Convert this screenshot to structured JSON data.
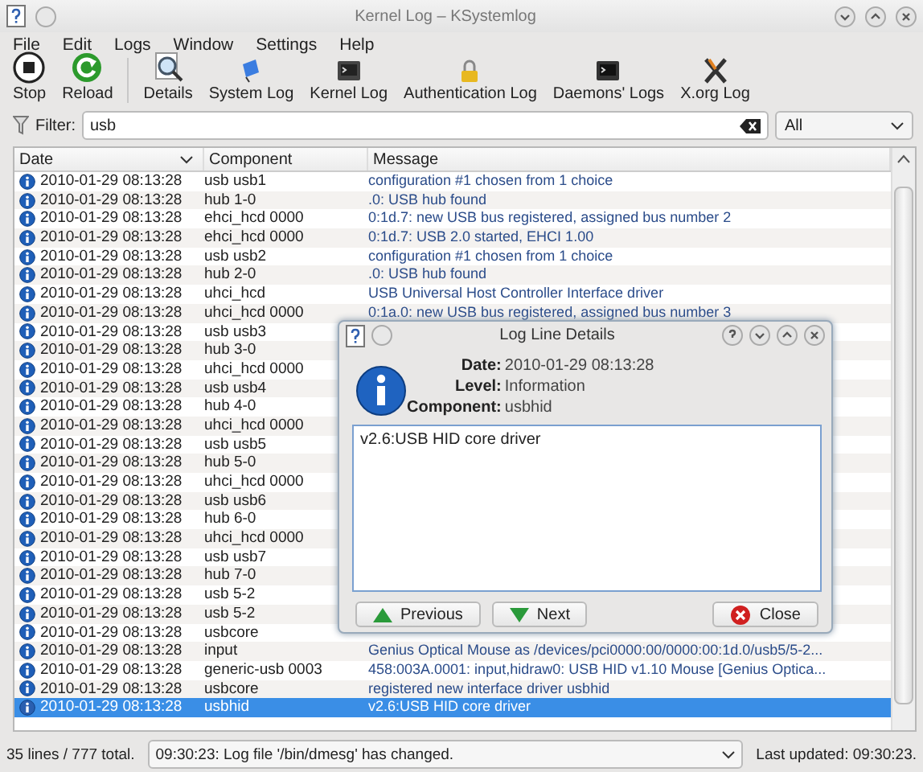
{
  "window": {
    "title": "Kernel Log – KSystemlog"
  },
  "menu": [
    "File",
    "Edit",
    "Logs",
    "Window",
    "Settings",
    "Help"
  ],
  "toolbar": [
    {
      "label": "Stop",
      "kind": "stop"
    },
    {
      "label": "Reload",
      "kind": "reload"
    },
    {
      "label": "Details",
      "kind": "details"
    },
    {
      "label": "System Log",
      "kind": "system"
    },
    {
      "label": "Kernel Log",
      "kind": "kernel"
    },
    {
      "label": "Authentication Log",
      "kind": "auth"
    },
    {
      "label": "Daemons' Logs",
      "kind": "daemons"
    },
    {
      "label": "X.org Log",
      "kind": "xorg"
    }
  ],
  "filter": {
    "label": "Filter:",
    "value": "usb",
    "scope": "All"
  },
  "table": {
    "columns": [
      {
        "label": "Date",
        "sorted": true
      },
      {
        "label": "Component",
        "sorted": false
      },
      {
        "label": "Message",
        "sorted": false
      }
    ],
    "rows": [
      {
        "date": "2010-01-29 08:13:28",
        "component": "usb usb1",
        "message": "configuration #1 chosen from 1 choice",
        "selected": false
      },
      {
        "date": "2010-01-29 08:13:28",
        "component": "hub 1-0",
        "message": ".0: USB hub found",
        "selected": false
      },
      {
        "date": "2010-01-29 08:13:28",
        "component": "ehci_hcd 0000",
        "message": "0:1d.7: new USB bus registered, assigned bus number 2",
        "selected": false
      },
      {
        "date": "2010-01-29 08:13:28",
        "component": "ehci_hcd 0000",
        "message": "0:1d.7: USB 2.0 started, EHCI 1.00",
        "selected": false
      },
      {
        "date": "2010-01-29 08:13:28",
        "component": "usb usb2",
        "message": "configuration #1 chosen from 1 choice",
        "selected": false
      },
      {
        "date": "2010-01-29 08:13:28",
        "component": "hub 2-0",
        "message": ".0: USB hub found",
        "selected": false
      },
      {
        "date": "2010-01-29 08:13:28",
        "component": "uhci_hcd",
        "message": "USB Universal Host Controller Interface driver",
        "selected": false
      },
      {
        "date": "2010-01-29 08:13:28",
        "component": "uhci_hcd 0000",
        "message": "0:1a.0: new USB bus registered, assigned bus number 3",
        "selected": false
      },
      {
        "date": "2010-01-29 08:13:28",
        "component": "usb usb3",
        "selected": false
      },
      {
        "date": "2010-01-29 08:13:28",
        "component": "hub 3-0",
        "selected": false
      },
      {
        "date": "2010-01-29 08:13:28",
        "component": "uhci_hcd 0000",
        "selected": false
      },
      {
        "date": "2010-01-29 08:13:28",
        "component": "usb usb4",
        "selected": false
      },
      {
        "date": "2010-01-29 08:13:28",
        "component": "hub 4-0",
        "selected": false
      },
      {
        "date": "2010-01-29 08:13:28",
        "component": "uhci_hcd 0000",
        "selected": false
      },
      {
        "date": "2010-01-29 08:13:28",
        "component": "usb usb5",
        "selected": false
      },
      {
        "date": "2010-01-29 08:13:28",
        "component": "hub 5-0",
        "selected": false
      },
      {
        "date": "2010-01-29 08:13:28",
        "component": "uhci_hcd 0000",
        "selected": false
      },
      {
        "date": "2010-01-29 08:13:28",
        "component": "usb usb6",
        "selected": false
      },
      {
        "date": "2010-01-29 08:13:28",
        "component": "hub 6-0",
        "selected": false
      },
      {
        "date": "2010-01-29 08:13:28",
        "component": "uhci_hcd 0000",
        "selected": false
      },
      {
        "date": "2010-01-29 08:13:28",
        "component": "usb usb7",
        "selected": false
      },
      {
        "date": "2010-01-29 08:13:28",
        "component": "hub 7-0",
        "selected": false
      },
      {
        "date": "2010-01-29 08:13:28",
        "component": "usb 5-2",
        "selected": false
      },
      {
        "date": "2010-01-29 08:13:28",
        "component": "usb 5-2",
        "selected": false
      },
      {
        "date": "2010-01-29 08:13:28",
        "component": "usbcore",
        "selected": false
      },
      {
        "date": "2010-01-29 08:13:28",
        "component": "input",
        "message": "Genius Optical Mouse as /devices/pci0000:00/0000:00:1d.0/usb5/5-2...",
        "selected": false
      },
      {
        "date": "2010-01-29 08:13:28",
        "component": "generic-usb 0003",
        "message": "458:003A.0001: input,hidraw0: USB HID v1.10 Mouse [Genius Optica...",
        "selected": false
      },
      {
        "date": "2010-01-29 08:13:28",
        "component": "usbcore",
        "message": "registered new interface driver usbhid",
        "selected": false
      },
      {
        "date": "2010-01-29 08:13:28",
        "component": "usbhid",
        "message": "v2.6:USB HID core driver",
        "selected": true
      }
    ]
  },
  "status_bar": {
    "count": "35 lines / 777 total.",
    "message": "09:30:23: Log file '/bin/dmesg' has changed.",
    "last_updated": "Last updated: 09:30:23."
  },
  "dialog": {
    "title": "Log Line Details",
    "fields": [
      {
        "label": "Date:",
        "value": "2010-01-29 08:13:28"
      },
      {
        "label": "Level:",
        "value": "Information"
      },
      {
        "label": "Component:",
        "value": "usbhid"
      }
    ],
    "text": "v2.6:USB HID core driver",
    "buttons": [
      {
        "label": "Previous",
        "kind": "previous"
      },
      {
        "label": "Next",
        "kind": "next"
      },
      {
        "label": "Close",
        "kind": "close"
      }
    ]
  }
}
